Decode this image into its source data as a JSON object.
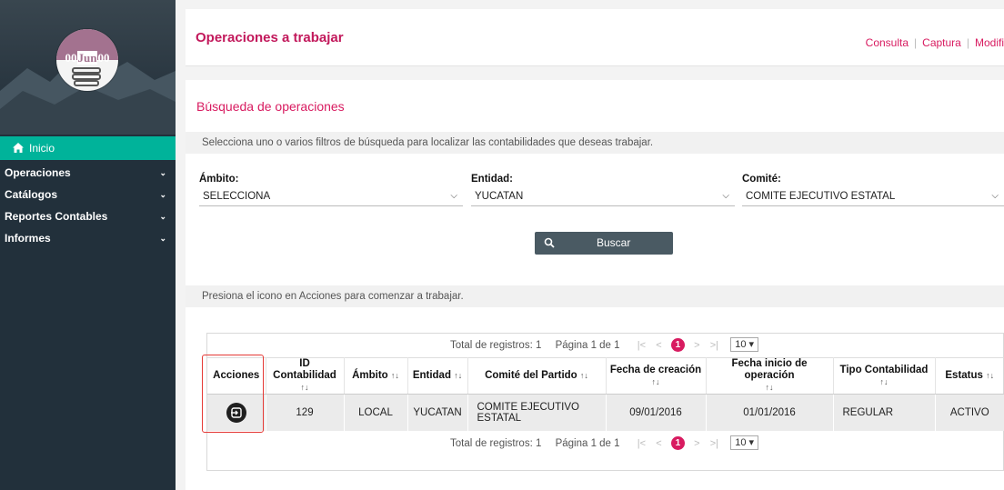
{
  "logo": {
    "date_left": "00",
    "date_mid": "Jun",
    "date_right": "00"
  },
  "sidebar": {
    "items": [
      {
        "label": "Inicio",
        "active": true
      },
      {
        "label": "Operaciones",
        "chevron": "⌄"
      },
      {
        "label": "Catálogos",
        "chevron": "⌄"
      },
      {
        "label": "Reportes Contables",
        "chevron": "⌄"
      },
      {
        "label": "Informes",
        "chevron": "⌄"
      }
    ]
  },
  "header": {
    "title": "Operaciones a trabajar",
    "links": [
      "Consulta",
      "Captura",
      "Modific"
    ]
  },
  "main": {
    "section_title": "Búsqueda de operaciones",
    "filter_hint": "Selecciona uno o varios filtros de búsqueda para localizar las contabilidades que deseas trabajar.",
    "filters": {
      "ambito": {
        "label": "Ámbito:",
        "value": "SELECCIONA"
      },
      "entidad": {
        "label": "Entidad:",
        "value": "YUCATAN"
      },
      "comite": {
        "label": "Comité:",
        "value": "COMITE EJECUTIVO ESTATAL"
      }
    },
    "search_label": "Buscar",
    "actions_hint": "Presiona el icono en Acciones para comenzar a trabajar."
  },
  "table": {
    "pager": {
      "total": "Total de registros: 1",
      "page": "Página 1 de 1",
      "first": "|<",
      "prev": "<",
      "current": "1",
      "next": ">",
      "last": ">|",
      "rows_per_page": "10 ▾"
    },
    "sort_glyph": "↑↓",
    "columns": [
      "Acciones",
      "ID Contabilidad",
      "Ámbito",
      "Entidad",
      "Comité del Partido",
      "Fecha de creación",
      "Fecha inicio de operación",
      "Tipo Contabilidad",
      "Estatus"
    ],
    "rows": [
      {
        "id": "129",
        "ambito": "LOCAL",
        "entidad": "YUCATAN",
        "comite": "COMITE EJECUTIVO ESTATAL",
        "fecha_creacion": "09/01/2016",
        "fecha_inicio": "01/01/2016",
        "tipo": "REGULAR",
        "estatus": "ACTIVO"
      }
    ]
  },
  "colors": {
    "accent": "#d81b60",
    "sidebar_bg": "#22303b",
    "active_nav": "#00b39a",
    "button": "#4a5a63",
    "highlight": "#e53935"
  }
}
